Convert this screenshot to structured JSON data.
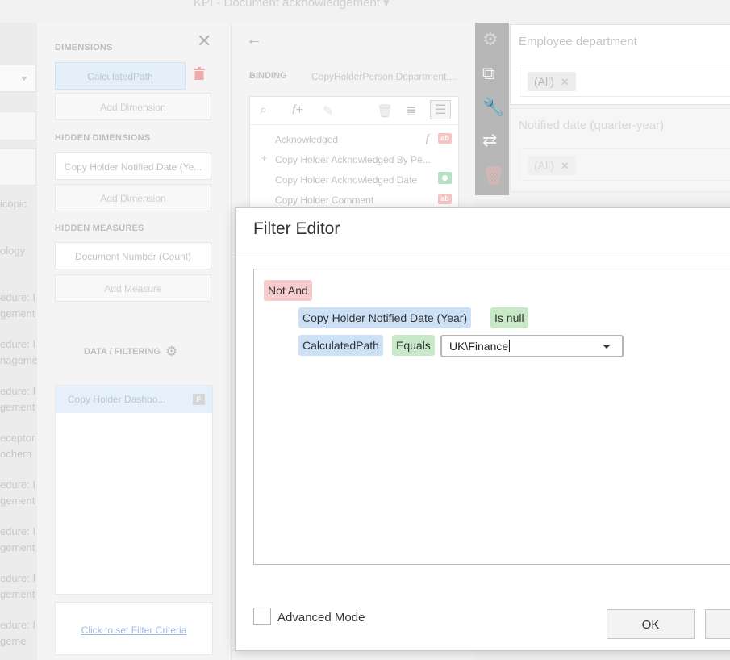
{
  "page": {
    "title": "KPI - Document acknowledgement",
    "left_items": [
      "icopic",
      "ology",
      "edure: I",
      "gement",
      "edure: I",
      "nageme",
      "edure: I",
      "gement",
      "eceptor",
      "ochem",
      "edure: I",
      "gement",
      "edure: I",
      "gement",
      "edure: I",
      "gement",
      "edure: I",
      "geme"
    ]
  },
  "dimensions_panel": {
    "dimensions_label": "DIMENSIONS",
    "dimension_item": "CalculatedPath",
    "add_dimension": "Add Dimension",
    "hidden_dimensions_label": "HIDDEN DIMENSIONS",
    "hidden_dimension_item": "Copy Holder Notified Date (Ye...",
    "add_hidden_dimension": "Add Dimension",
    "hidden_measures_label": "HIDDEN MEASURES",
    "hidden_measure_item": "Document Number (Count)",
    "add_measure": "Add Measure",
    "data_filtering_label": "DATA / FILTERING",
    "filter_item": "Copy Holder Dashbo...",
    "filter_badge": "F",
    "criteria_link": "Click to set Filter Criteria"
  },
  "binding_panel": {
    "binding_label": "BINDING",
    "binding_value": "CopyHolderPerson.Department....",
    "fields": [
      {
        "name": "Acknowledged",
        "type": "ab"
      },
      {
        "name": "Copy Holder Acknowledged By Pe...",
        "type": "group"
      },
      {
        "name": "Copy Holder Acknowledged Date",
        "type": "date"
      },
      {
        "name": "Copy Holder Comment",
        "type": "ab"
      }
    ],
    "type_badge_text": "ab"
  },
  "right_cards": {
    "employee_department": {
      "title": "Employee department",
      "tag": "(All)"
    },
    "notified_date": {
      "title": "Notified date (quarter-year)",
      "tag": "(All)"
    }
  },
  "filter_editor": {
    "title": "Filter Editor",
    "group_operator": "Not And",
    "conditions": [
      {
        "field": "Copy Holder Notified Date (Year)",
        "operator": "Is null"
      },
      {
        "field": "CalculatedPath",
        "operator": "Equals",
        "value": "UK\\Finance"
      }
    ],
    "advanced_mode_label": "Advanced Mode",
    "advanced_mode_checked": false,
    "ok_label": "OK",
    "cancel_label": ""
  },
  "colors": {
    "group_chip": "#f6cccc",
    "field_chip": "#cce0f6",
    "operator_chip": "#c7e9c7",
    "toolbar_bg": "#b7b7b7"
  }
}
